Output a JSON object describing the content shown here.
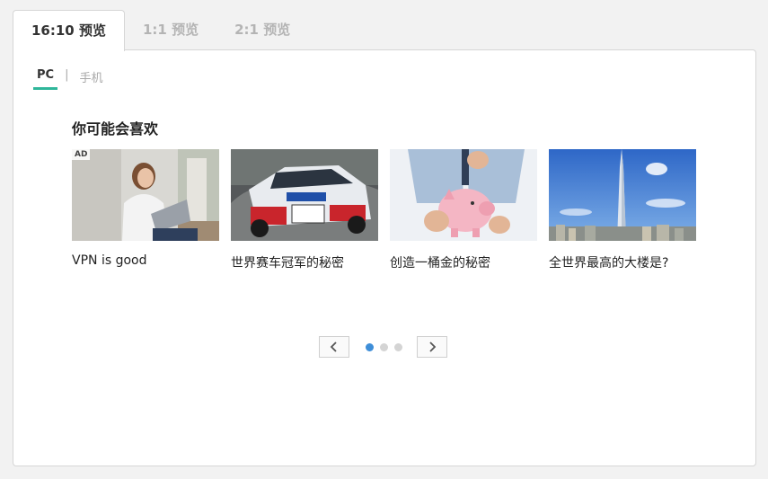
{
  "tabs": [
    {
      "label": "16:10 预览",
      "active": true
    },
    {
      "label": "1:1 预览",
      "active": false
    },
    {
      "label": "2:1 预览",
      "active": false
    }
  ],
  "device_switch": {
    "pc": "PC",
    "separator": "|",
    "mobile": "手机",
    "active": "PC"
  },
  "section": {
    "title": "你可能会喜欢"
  },
  "cards": [
    {
      "title": "VPN is good",
      "ad_badge": "AD",
      "image": "woman-with-laptop"
    },
    {
      "title": "世界赛车冠军的秘密",
      "image": "rally-car"
    },
    {
      "title": "创造一桶金的秘密",
      "image": "piggy-bank"
    },
    {
      "title": "全世界最高的大楼是?",
      "image": "skyscraper"
    }
  ],
  "pager": {
    "prev_icon": "chevron-left-icon",
    "next_icon": "chevron-right-icon",
    "page_count": 3,
    "current_page": 1
  },
  "colors": {
    "accent_underline": "#2fb69a",
    "active_dot": "#3e8ed8",
    "inactive_dot": "#d4d4d4"
  }
}
